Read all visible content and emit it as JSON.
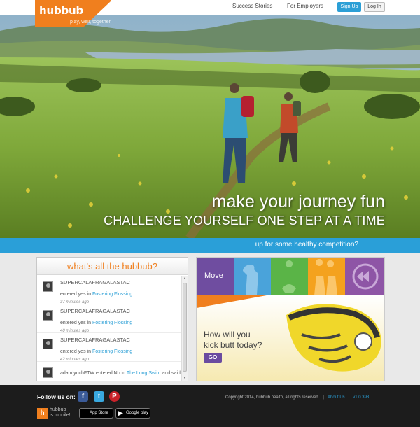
{
  "header": {
    "logo": "hubbub",
    "tagline": "play, well, together",
    "nav": [
      "Success Stories",
      "For Employers"
    ],
    "signup_label": "Sign Up",
    "login_label": "Log In"
  },
  "hero": {
    "headline": "make your journey fun",
    "subheadline": "CHALLENGE YOURSELF ONE STEP AT A TIME",
    "banner": "up for some healthy competition?"
  },
  "feed": {
    "title": "what's all the hubbub?",
    "items": [
      {
        "user": "SUPERCALAFRAGALASTAC",
        "action": "entered yes in",
        "link": "Fostering Flossing",
        "time": "37 minutes ago"
      },
      {
        "user": "SUPERCALAFRAGALASTAC",
        "action": "entered yes in",
        "link": "Fostering Flossing",
        "time": "40 minutes ago"
      },
      {
        "user": "SUPERCALAFRAGALASTAC",
        "action": "entered yes in",
        "link": "Fostering Flossing",
        "time": "42 minutes ago"
      },
      {
        "user": "adamlynchFTW",
        "action": "entered No in",
        "link": "The Long Swim",
        "extra": "and said, \"Swim?\""
      }
    ]
  },
  "promo": {
    "move_label": "Move",
    "headline_line1": "How will you",
    "headline_line2": "kick butt today?",
    "go_label": "GO"
  },
  "footer": {
    "follow_label": "Follow us on:",
    "mobile_line1": "hubbub",
    "mobile_line2": "is mobile!",
    "appstore_label": "App Store",
    "gplay_label": "Google play",
    "copyright": "Copyright 2014, hubbub health, all rights reserved.",
    "about_label": "About Us",
    "version": "v1.0.393"
  },
  "colors": {
    "brand_orange": "#f07f1e",
    "accent_blue": "#2a9fd8",
    "purple": "#6f4da0"
  }
}
